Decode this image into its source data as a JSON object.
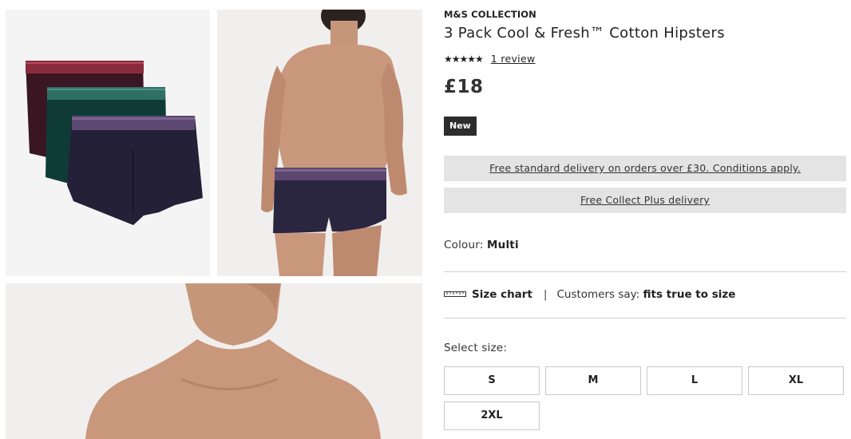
{
  "gallery": {
    "images": [
      {
        "alt": "3 pack hipsters flat lay"
      },
      {
        "alt": "model back view"
      },
      {
        "alt": "model front upper body"
      }
    ]
  },
  "product": {
    "brand": "M&S COLLECTION",
    "title": "3 Pack Cool & Fresh™ Cotton Hipsters",
    "stars": "★★★★★",
    "review_link": "1 review",
    "price": "£18",
    "badge": "New"
  },
  "delivery": {
    "standard": "Free standard delivery on orders over £30. Conditions apply.",
    "collect": "Free Collect Plus delivery"
  },
  "colour": {
    "label": "Colour:",
    "value": "Multi"
  },
  "size_info": {
    "size_chart": "Size chart",
    "separator": "|",
    "customers_say": "Customers say:",
    "fit": "fits true to size"
  },
  "sizes": {
    "label": "Select size:",
    "options": [
      "S",
      "M",
      "L",
      "XL",
      "2XL"
    ]
  },
  "colors": {
    "badge_bg": "#2d2d2d",
    "banner_bg": "#e4e4e4",
    "maroon": "#3a1623",
    "teal": "#0f3b36",
    "navy": "#232038"
  }
}
